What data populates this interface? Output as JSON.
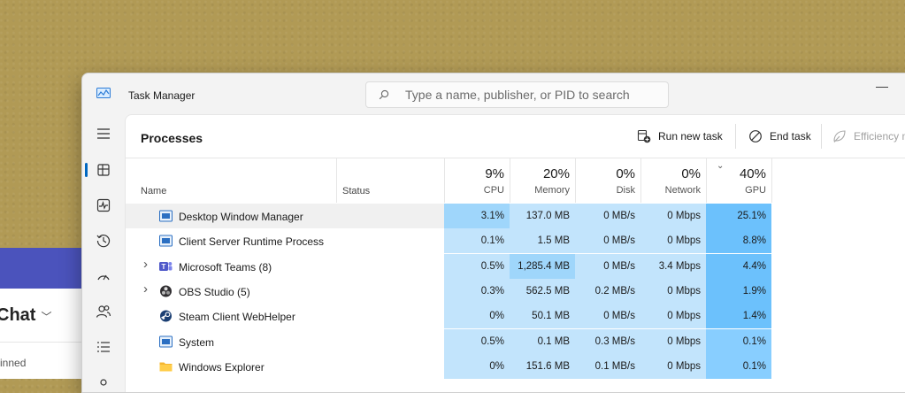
{
  "background_app": {
    "title": "Chat",
    "subtitle": "inned"
  },
  "window": {
    "title": "Task Manager",
    "minimize_glyph": "—",
    "search": {
      "placeholder": "Type a name, publisher, or PID to search",
      "value": ""
    }
  },
  "nav": {
    "items": [
      {
        "icon": "hamburger-menu-icon"
      },
      {
        "icon": "processes-icon",
        "active": true
      },
      {
        "icon": "performance-icon"
      },
      {
        "icon": "app-history-icon"
      },
      {
        "icon": "startup-apps-icon"
      },
      {
        "icon": "users-icon"
      },
      {
        "icon": "details-icon"
      },
      {
        "icon": "services-icon"
      }
    ]
  },
  "toolbar": {
    "page_title": "Processes",
    "run_new_task": "Run new task",
    "end_task": "End task",
    "efficiency": "Efficiency m"
  },
  "columns": {
    "name": "Name",
    "status": "Status",
    "cpu": {
      "pct": "9%",
      "label": "CPU"
    },
    "memory": {
      "pct": "20%",
      "label": "Memory"
    },
    "disk": {
      "pct": "0%",
      "label": "Disk"
    },
    "network": {
      "pct": "0%",
      "label": "Network"
    },
    "gpu": {
      "pct": "40%",
      "label": "GPU"
    }
  },
  "rows": [
    {
      "name": "Desktop Window Manager",
      "expandable": false,
      "icon": "window-app-icon",
      "cpu": "3.1%",
      "memory": "137.0 MB",
      "disk": "0 MB/s",
      "network": "0 Mbps",
      "gpu": "25.1%",
      "selected": true
    },
    {
      "name": "Client Server Runtime Process",
      "expandable": false,
      "icon": "window-app-icon",
      "cpu": "0.1%",
      "memory": "1.5 MB",
      "disk": "0 MB/s",
      "network": "0 Mbps",
      "gpu": "8.8%"
    },
    {
      "name": "Microsoft Teams (8)",
      "expandable": true,
      "icon": "teams-icon",
      "cpu": "0.5%",
      "memory": "1,285.4 MB",
      "disk": "0 MB/s",
      "network": "3.4 Mbps",
      "gpu": "4.4%"
    },
    {
      "name": "OBS Studio (5)",
      "expandable": true,
      "icon": "obs-icon",
      "cpu": "0.3%",
      "memory": "562.5 MB",
      "disk": "0.2 MB/s",
      "network": "0 Mbps",
      "gpu": "1.9%"
    },
    {
      "name": "Steam Client WebHelper",
      "expandable": false,
      "icon": "steam-icon",
      "cpu": "0%",
      "memory": "50.1 MB",
      "disk": "0 MB/s",
      "network": "0 Mbps",
      "gpu": "1.4%"
    },
    {
      "name": "System",
      "expandable": false,
      "icon": "window-app-icon",
      "cpu": "0.5%",
      "memory": "0.1 MB",
      "disk": "0.3 MB/s",
      "network": "0 Mbps",
      "gpu": "0.1%"
    },
    {
      "name": "Windows Explorer",
      "expandable": false,
      "icon": "folder-icon",
      "cpu": "0%",
      "memory": "151.6 MB",
      "disk": "0.1 MB/s",
      "network": "0 Mbps",
      "gpu": "0.1%"
    }
  ],
  "colors": {
    "heat_light": "#ddf0ff",
    "heat_medium": "#c2e4fc",
    "heat_strong": "#9fd6fb",
    "heat_gpu": "#88ceff",
    "heat_gpu_high": "#6cc1fc",
    "accent": "#0067c0"
  }
}
